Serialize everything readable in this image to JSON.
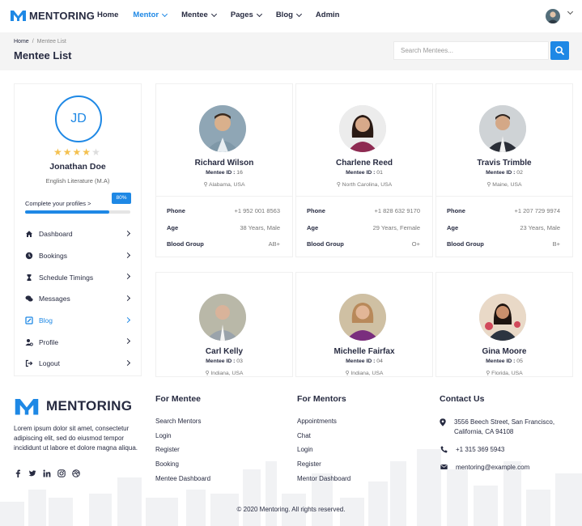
{
  "brand": {
    "name": "MENTORING",
    "accent": "#1e88e5"
  },
  "nav": [
    {
      "label": "Home",
      "active": false,
      "dropdown": false
    },
    {
      "label": "Mentor",
      "active": true,
      "dropdown": true
    },
    {
      "label": "Mentee",
      "active": false,
      "dropdown": true
    },
    {
      "label": "Pages",
      "active": false,
      "dropdown": true
    },
    {
      "label": "Blog",
      "active": false,
      "dropdown": true
    },
    {
      "label": "Admin",
      "active": false,
      "dropdown": false
    }
  ],
  "breadcrumb": {
    "home": "Home",
    "sep": "/",
    "current": "Mentee List"
  },
  "page_title": "Mentee List",
  "search": {
    "placeholder": "Search Mentees..."
  },
  "profile": {
    "initials": "JD",
    "rating": 4,
    "max_rating": 5,
    "name": "Jonathan Doe",
    "subtitle": "English Literature (M.A)",
    "progress_label": "Complete your profiles >",
    "progress_value": 0.8,
    "progress_text": "80%"
  },
  "menu": [
    {
      "label": "Dashboard",
      "icon": "home-icon",
      "active": false
    },
    {
      "label": "Bookings",
      "icon": "clock-icon",
      "active": false
    },
    {
      "label": "Schedule Timings",
      "icon": "hourglass-icon",
      "active": false
    },
    {
      "label": "Messages",
      "icon": "chat-icon",
      "active": false
    },
    {
      "label": "Blog",
      "icon": "blog-icon",
      "active": true
    },
    {
      "label": "Profile",
      "icon": "user-cog-icon",
      "active": false
    },
    {
      "label": "Logout",
      "icon": "logout-icon",
      "active": false
    }
  ],
  "labels": {
    "mentee_id": "Mentee ID :",
    "phone": "Phone",
    "age": "Age",
    "blood": "Blood Group"
  },
  "mentees": [
    {
      "name": "Richard Wilson",
      "id": "16",
      "location": "Alabama, USA",
      "phone": "+1 952 001 8563",
      "age": "38 Years, Male",
      "blood": "AB+"
    },
    {
      "name": "Charlene Reed",
      "id": "01",
      "location": "North Carolina, USA",
      "phone": "+1 828 632 9170",
      "age": "29 Years, Female",
      "blood": "O+"
    },
    {
      "name": "Travis Trimble",
      "id": "02",
      "location": "Maine, USA",
      "phone": "+1 207 729 9974",
      "age": "23 Years, Male",
      "blood": "B+"
    },
    {
      "name": "Carl Kelly",
      "id": "03",
      "location": "Indiana, USA"
    },
    {
      "name": "Michelle Fairfax",
      "id": "04",
      "location": "Indiana, USA"
    },
    {
      "name": "Gina Moore",
      "id": "05",
      "location": "Florida, USA"
    }
  ],
  "footer": {
    "description": "Lorem ipsum dolor sit amet, consectetur adipiscing elit, sed do eiusmod tempor incididunt ut labore et dolore magna aliqua.",
    "socials": [
      "facebook-icon",
      "twitter-icon",
      "linkedin-icon",
      "instagram-icon",
      "dribbble-icon"
    ],
    "for_mentee": {
      "title": "For Mentee",
      "links": [
        "Search Mentors",
        "Login",
        "Register",
        "Booking",
        "Mentee Dashboard"
      ]
    },
    "for_mentors": {
      "title": "For Mentors",
      "links": [
        "Appointments",
        "Chat",
        "Login",
        "Register",
        "Mentor Dashboard"
      ]
    },
    "contact": {
      "title": "Contact Us",
      "address": "3556 Beech Street, San Francisco, California, CA 94108",
      "phone": "+1 315 369 5943",
      "email": "mentoring@example.com"
    },
    "copyright": "© 2020 Mentoring. All rights reserved."
  }
}
